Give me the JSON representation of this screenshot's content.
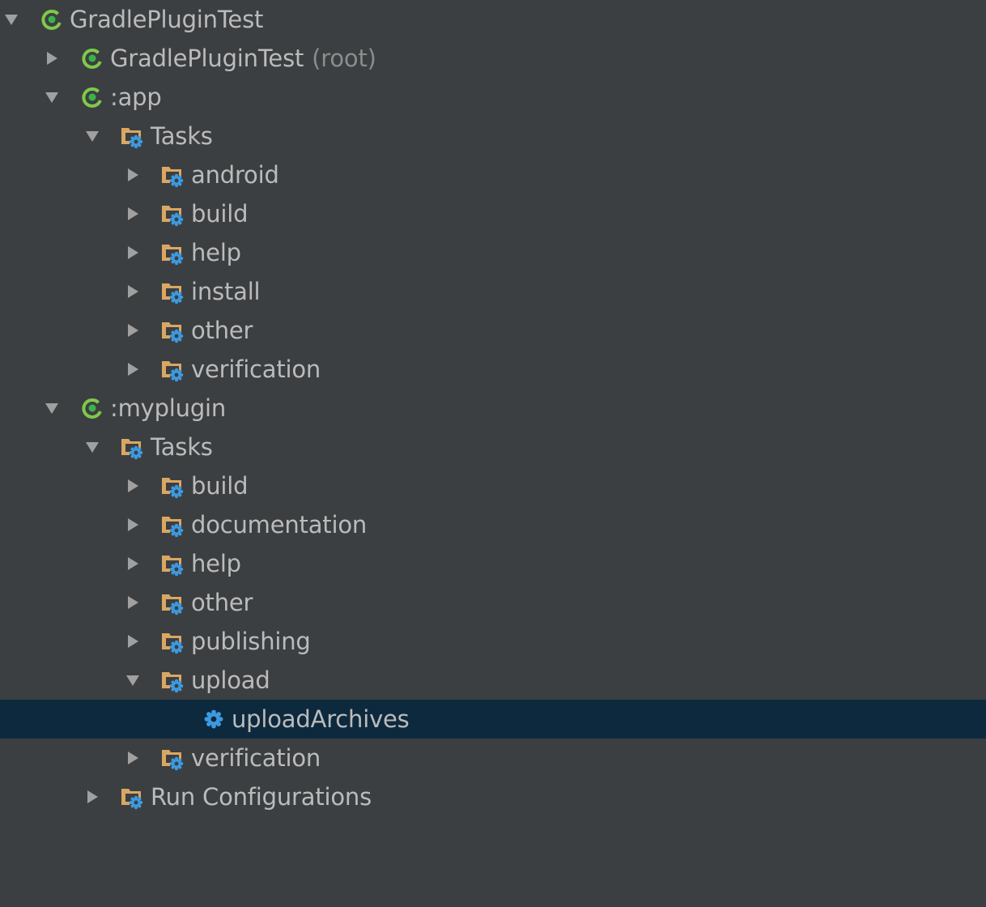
{
  "panel": "Gradle projects tool window",
  "colors": {
    "background": "#3c3f41",
    "selection": "#0d293e",
    "text": "#bbbbbb",
    "muted_text": "#8c8c8c",
    "gradle_green": "#7ec94a",
    "folder_tan": "#d9a764",
    "gear_blue": "#3d9ae0",
    "arrow_gray": "#a0a0a0"
  },
  "tree": [
    {
      "label": "GradlePluginTest",
      "level": 0,
      "state": "expanded",
      "icon": "gradle-project-icon"
    },
    {
      "label": "GradlePluginTest",
      "suffix": "(root)",
      "level": 1,
      "state": "collapsed",
      "icon": "gradle-project-icon"
    },
    {
      "label": ":app",
      "level": 1,
      "state": "expanded",
      "icon": "gradle-project-icon"
    },
    {
      "label": "Tasks",
      "level": 2,
      "state": "expanded",
      "icon": "task-folder-icon"
    },
    {
      "label": "android",
      "level": 3,
      "state": "collapsed",
      "icon": "task-folder-icon"
    },
    {
      "label": "build",
      "level": 3,
      "state": "collapsed",
      "icon": "task-folder-icon"
    },
    {
      "label": "help",
      "level": 3,
      "state": "collapsed",
      "icon": "task-folder-icon"
    },
    {
      "label": "install",
      "level": 3,
      "state": "collapsed",
      "icon": "task-folder-icon"
    },
    {
      "label": "other",
      "level": 3,
      "state": "collapsed",
      "icon": "task-folder-icon"
    },
    {
      "label": "verification",
      "level": 3,
      "state": "collapsed",
      "icon": "task-folder-icon"
    },
    {
      "label": ":myplugin",
      "level": 1,
      "state": "expanded",
      "icon": "gradle-project-icon"
    },
    {
      "label": "Tasks",
      "level": 2,
      "state": "expanded",
      "icon": "task-folder-icon"
    },
    {
      "label": "build",
      "level": 3,
      "state": "collapsed",
      "icon": "task-folder-icon"
    },
    {
      "label": "documentation",
      "level": 3,
      "state": "collapsed",
      "icon": "task-folder-icon"
    },
    {
      "label": "help",
      "level": 3,
      "state": "collapsed",
      "icon": "task-folder-icon"
    },
    {
      "label": "other",
      "level": 3,
      "state": "collapsed",
      "icon": "task-folder-icon"
    },
    {
      "label": "publishing",
      "level": 3,
      "state": "collapsed",
      "icon": "task-folder-icon"
    },
    {
      "label": "upload",
      "level": 3,
      "state": "expanded",
      "icon": "task-folder-icon"
    },
    {
      "label": "uploadArchives",
      "level": 4,
      "state": "leaf",
      "icon": "gear-icon",
      "selected": true
    },
    {
      "label": "verification",
      "level": 3,
      "state": "collapsed",
      "icon": "task-folder-icon"
    },
    {
      "label": "Run Configurations",
      "level": 2,
      "state": "collapsed",
      "icon": "task-folder-icon"
    }
  ]
}
